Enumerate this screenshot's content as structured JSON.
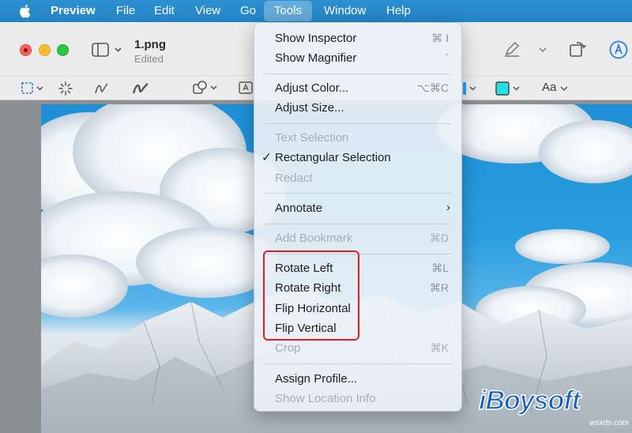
{
  "menubar": {
    "app_name": "Preview",
    "items": [
      "File",
      "Edit",
      "View",
      "Go",
      "Tools",
      "Window",
      "Help"
    ],
    "active": "Tools"
  },
  "toolbar": {
    "doc_title": "1.png",
    "doc_status": "Edited",
    "font_button": "Aa",
    "border_color": "#2d9bf0",
    "fill_color": "#22e0e6"
  },
  "menu": {
    "items": [
      {
        "label": "Show Inspector",
        "shortcut": "⌘ I",
        "enabled": true
      },
      {
        "label": "Show Magnifier",
        "shortcut": "`",
        "enabled": true
      },
      {
        "label": "Adjust Color...",
        "shortcut": "⌥⌘C",
        "enabled": true
      },
      {
        "label": "Adjust Size...",
        "shortcut": "",
        "enabled": true
      },
      {
        "label": "Text Selection",
        "shortcut": "",
        "enabled": false
      },
      {
        "label": "Rectangular Selection",
        "shortcut": "",
        "enabled": true,
        "checked": true
      },
      {
        "label": "Redact",
        "shortcut": "",
        "enabled": false
      },
      {
        "label": "Annotate",
        "shortcut": "",
        "enabled": true,
        "submenu": true
      },
      {
        "label": "Add Bookmark",
        "shortcut": "⌘D",
        "enabled": false
      },
      {
        "label": "Rotate Left",
        "shortcut": "⌘L",
        "enabled": true
      },
      {
        "label": "Rotate Right",
        "shortcut": "⌘R",
        "enabled": true
      },
      {
        "label": "Flip Horizontal",
        "shortcut": "",
        "enabled": true
      },
      {
        "label": "Flip Vertical",
        "shortcut": "",
        "enabled": true
      },
      {
        "label": "Crop",
        "shortcut": "⌘K",
        "enabled": false
      },
      {
        "label": "Assign Profile...",
        "shortcut": "",
        "enabled": true
      },
      {
        "label": "Show Location Info",
        "shortcut": "",
        "enabled": false
      }
    ],
    "check_glyph": "✓",
    "submenu_glyph": "›"
  },
  "watermark": {
    "brand": "iBoysoft",
    "site": "wsxdn.com"
  },
  "colors": {
    "menubar": "#2584c6",
    "highlight": "#e02020"
  }
}
